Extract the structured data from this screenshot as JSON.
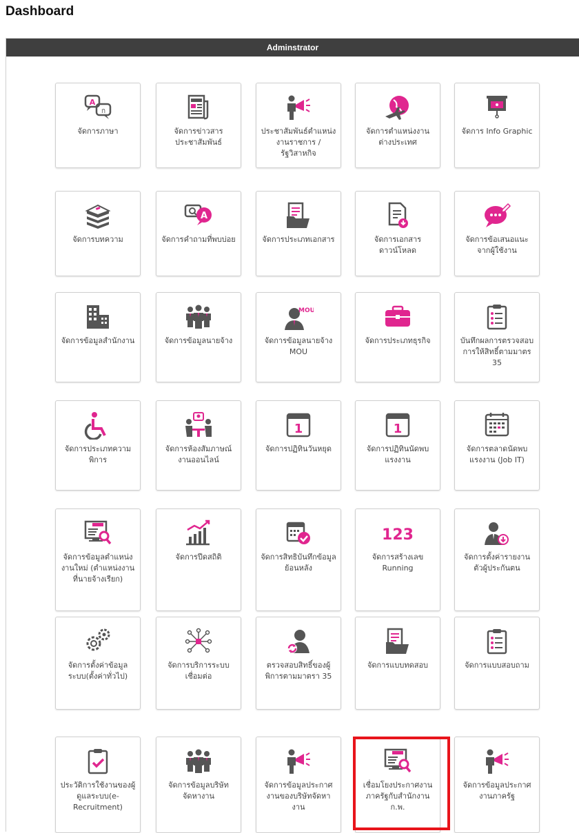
{
  "page": {
    "title": "Dashboard"
  },
  "panel": {
    "header": "Adminstrator"
  },
  "colors": {
    "accent": "#e0268f",
    "icon_dark": "#555555",
    "header_bg": "#3f3f3f",
    "highlight": "#e8141b"
  },
  "tiles": [
    {
      "label": "จัดการภาษา",
      "icon": "translate-icon"
    },
    {
      "label": "จัดการข่าวสารประชาสัมพันธ์",
      "icon": "newspaper-icon"
    },
    {
      "label": "ประชาสัมพันธ์ตำแหน่งงานราชการ / รัฐวิสาหกิจ",
      "icon": "megaphone-icon"
    },
    {
      "label": "จัดการตำแหน่งงานต่างประเทศ",
      "icon": "globe-plane-icon"
    },
    {
      "label": "จัดการ Info Graphic",
      "icon": "projector-screen-icon"
    },
    {
      "label": "จัดการบทความ",
      "icon": "books-icon"
    },
    {
      "label": "จัดการคำถามที่พบบ่อย",
      "icon": "faq-chat-icon"
    },
    {
      "label": "จัดการประเภทเอกสาร",
      "icon": "document-folder-icon"
    },
    {
      "label": "จัดการเอกสารดาวน์โหลด",
      "icon": "document-download-icon"
    },
    {
      "label": "จัดการข้อเสนอแนะจากผู้ใช้งาน",
      "icon": "feedback-bubble-icon"
    },
    {
      "label": "จัดการข้อมูลสำนักงาน",
      "icon": "office-building-icon"
    },
    {
      "label": "จัดการข้อมูลนายจ้าง",
      "icon": "employers-group-icon"
    },
    {
      "label": "จัดการข้อมูลนายจ้าง MOU",
      "icon": "mou-employer-icon"
    },
    {
      "label": "จัดการประเภทธุรกิจ",
      "icon": "briefcase-icon"
    },
    {
      "label": "บันทึกผลการตรวจสอบการให้สิทธิ์ตามมาตร 35",
      "icon": "clipboard-list-icon"
    },
    {
      "label": "จัดการประเภทความพิการ",
      "icon": "wheelchair-icon"
    },
    {
      "label": "จัดการห้องสัมภาษณ์งานออนไลน์",
      "icon": "interview-room-icon"
    },
    {
      "label": "จัดการปฏิทินวันหยุด",
      "icon": "calendar-1-icon"
    },
    {
      "label": "จัดการปฏิทินนัดพบแรงงาน",
      "icon": "calendar-1-icon"
    },
    {
      "label": "จัดการตลาดนัดพบแรงงาน (Job IT)",
      "icon": "calendar-grid-icon"
    },
    {
      "label": "จัดการข้อมูลตำแหน่งงานใหม่ (ตำแหน่งงานที่นายจ้างเรียก)",
      "icon": "job-search-screen-icon"
    },
    {
      "label": "จัดการปีดสถิติ",
      "icon": "bar-chart-icon"
    },
    {
      "label": "จัดการสิทธิบันทึกข้อมูลย้อนหลัง",
      "icon": "calendar-check-icon"
    },
    {
      "label": "จัดการสร้างเลข Running",
      "icon": "numbers-123-icon"
    },
    {
      "label": "จัดการตั้งค่ารายงานตัวผู้ประกันตน",
      "icon": "user-download-icon"
    },
    {
      "label": "จัดการตั้งค่าข้อมูลระบบ(ตั้งค่าทั่วไป)",
      "icon": "gears-icon"
    },
    {
      "label": "จัดการบริการระบบเชื่อมต่อ",
      "icon": "network-nodes-icon"
    },
    {
      "label": "ตรวจสอบสิทธิ์ของผู้พิการตามมาตรา 35",
      "icon": "user-refresh-icon"
    },
    {
      "label": "จัดการแบบทดสอบ",
      "icon": "document-folder-icon"
    },
    {
      "label": "จัดการแบบสอบถาม",
      "icon": "clipboard-list-icon"
    },
    {
      "label": "ประวัติการใช้งานของผู้ดูแลระบบ(e-Recruitment)",
      "icon": "clipboard-check-icon"
    },
    {
      "label": "จัดการข้อมูลบริษัทจัดหางาน",
      "icon": "employers-group-icon"
    },
    {
      "label": "จัดการข้อมูลประกาศงานของบริษัทจัดหางาน",
      "icon": "megaphone-icon"
    },
    {
      "label": "เชื่อมโยงประกาศงานภาครัฐกับสำนักงาน ก.พ.",
      "icon": "job-search-screen-icon"
    },
    {
      "label": "จัดการข้อมูลประกาศงานภาครัฐ",
      "icon": "megaphone-icon"
    }
  ]
}
